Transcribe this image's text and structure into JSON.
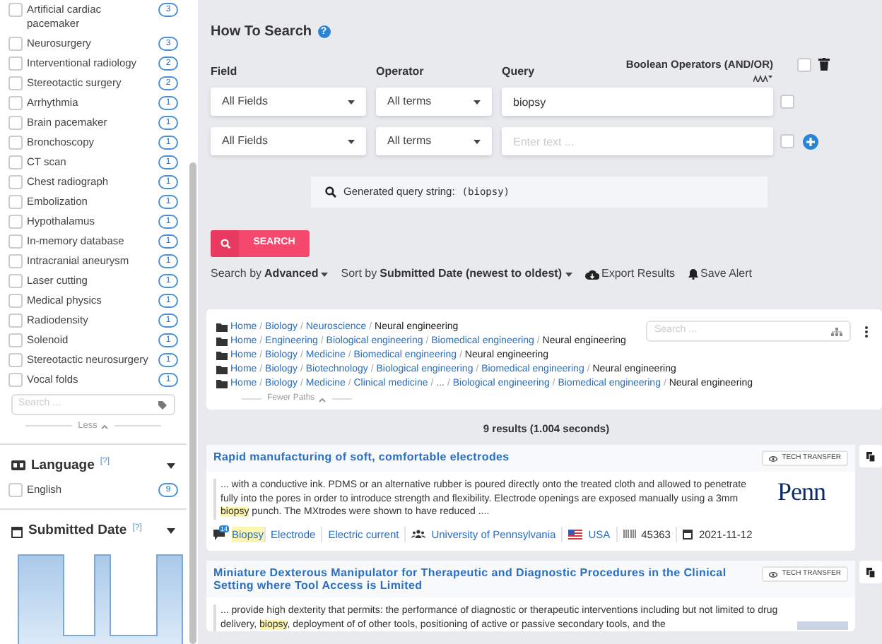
{
  "sidebar": {
    "topic_facet": {
      "items": [
        {
          "label": "Artificial cardiac pacemaker",
          "count": "3",
          "checked": false
        },
        {
          "label": "Neurosurgery",
          "count": "3",
          "checked": false
        },
        {
          "label": "Interventional radiology",
          "count": "2",
          "checked": false
        },
        {
          "label": "Stereotactic surgery",
          "count": "2",
          "checked": false
        },
        {
          "label": "Arrhythmia",
          "count": "1",
          "checked": false
        },
        {
          "label": "Brain pacemaker",
          "count": "1",
          "checked": false
        },
        {
          "label": "Bronchoscopy",
          "count": "1",
          "checked": false
        },
        {
          "label": "CT scan",
          "count": "1",
          "checked": false
        },
        {
          "label": "Chest radiograph",
          "count": "1",
          "checked": false
        },
        {
          "label": "Embolization",
          "count": "1",
          "checked": false
        },
        {
          "label": "Hypothalamus",
          "count": "1",
          "checked": false
        },
        {
          "label": "In-memory database",
          "count": "1",
          "checked": false
        },
        {
          "label": "Intracranial aneurysm",
          "count": "1",
          "checked": false
        },
        {
          "label": "Laser cutting",
          "count": "1",
          "checked": false
        },
        {
          "label": "Medical physics",
          "count": "1",
          "checked": false
        },
        {
          "label": "Radiodensity",
          "count": "1",
          "checked": false
        },
        {
          "label": "Solenoid",
          "count": "1",
          "checked": false
        },
        {
          "label": "Stereotactic neurosurgery",
          "count": "1",
          "checked": false
        },
        {
          "label": "Vocal folds",
          "count": "1",
          "checked": false
        }
      ],
      "search_placeholder": "Search ...",
      "toggle": "Less"
    },
    "language_facet": {
      "title": "Language",
      "help": "[?]",
      "items": [
        {
          "label": "English",
          "count": "9",
          "checked": false
        }
      ]
    },
    "date_facet": {
      "title": "Submitted Date",
      "help": "[?]"
    }
  },
  "how_to_search": {
    "title": "How To Search",
    "help_icon": "?",
    "boolean_checked": false,
    "columns": [
      "Field",
      "Operator",
      "Query",
      "Boolean Operators (AND/OR)"
    ],
    "rows": [
      {
        "field": "All Fields",
        "operator": "All terms",
        "query": "biopsy",
        "checked": false
      },
      {
        "field": "All Fields",
        "operator": "All terms",
        "placeholder": "Enter text ...",
        "checked": false
      }
    ],
    "generated_query": {
      "label": "Generated query string:",
      "value": "(biopsy)"
    },
    "search_button": "SEARCH"
  },
  "toolbar": {
    "search_by": {
      "label": "Search by",
      "value": "Advanced"
    },
    "sort_by": {
      "label": "Sort by",
      "value": "Submitted Date (newest to oldest)"
    },
    "actions": [
      {
        "kind": "export",
        "label": "Export Results"
      },
      {
        "kind": "alert",
        "label": "Save Alert"
      }
    ]
  },
  "category_paths": {
    "paths": [
      {
        "links": [
          "Home",
          "Biology",
          "Neuroscience"
        ],
        "current": "Neural engineering"
      },
      {
        "links": [
          "Home",
          "Engineering",
          "Biological engineering",
          "Biomedical engineering"
        ],
        "current": "Neural engineering"
      },
      {
        "links": [
          "Home",
          "Biology",
          "Medicine",
          "Biomedical engineering"
        ],
        "current": "Neural engineering"
      },
      {
        "links": [
          "Home",
          "Biology",
          "Biotechnology",
          "Biological engineering",
          "Biomedical engineering"
        ],
        "current": "Neural engineering"
      },
      {
        "links": [
          "Home",
          "Biology",
          "Medicine",
          "Clinical medicine",
          "...",
          "Biological engineering",
          "Biomedical engineering"
        ],
        "current": "Neural engineering"
      }
    ],
    "separator": "/",
    "search_placeholder": "Search ...",
    "toggle": "Fewer Paths"
  },
  "results_summary": "9 results (1.004 seconds)",
  "results": [
    {
      "title": "Rapid manufacturing of soft, comfortable electrodes",
      "badge": "TECH TRANSFER",
      "snippet": [
        {
          "text": "... with a conductive ink. PDMS or an alternative rubber is poured directly onto the treated cloth and allowed to penetrate fully into the pores in order to introduce strength and flexibility. Electrode openings are exposed manually using a 3mm ",
          "highlight": false
        },
        {
          "text": "biopsy",
          "highlight": true
        },
        {
          "text": " punch. The MXtrodes were shown to have reduced ....",
          "highlight": false
        }
      ],
      "logo": "Penn",
      "comment_count": "14",
      "tags": [
        {
          "text": "Biopsy",
          "highlight": true
        },
        {
          "text": "Electrode",
          "highlight": false
        },
        {
          "text": "Electric current",
          "highlight": false
        }
      ],
      "organization": "University of Pennsylvania",
      "country": "USA",
      "id": "45363",
      "date": "2021-11-12"
    },
    {
      "title": "Miniature Dexterous Manipulator for Therapeutic and Diagnostic Procedures in the Clinical Setting where Tool Access is Limited",
      "badge": "TECH TRANSFER",
      "snippet": [
        {
          "text": "... provide high dexterity that permits: the performance of diagnostic or therapeutic interventions including but not limited to drug delivery, ",
          "highlight": false
        },
        {
          "text": "biopsy",
          "highlight": true
        },
        {
          "text": ", deployment of of other tools, positioning of active or passive secondary tools, and the",
          "highlight": false
        }
      ]
    }
  ]
}
